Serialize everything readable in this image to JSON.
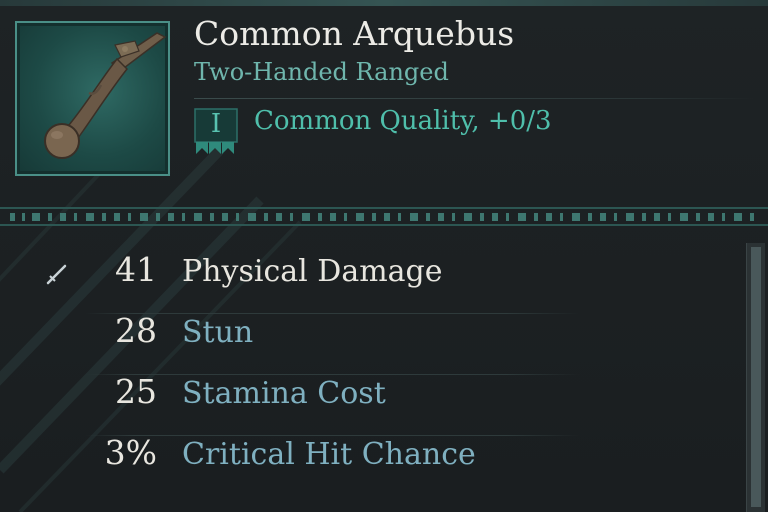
{
  "item": {
    "name": "Common Arquebus",
    "type": "Two-Handed Ranged",
    "quality_numeral": "I",
    "quality_text": "Common Quality, +0/3",
    "icon": "arquebus-icon"
  },
  "stats": [
    {
      "value": "41",
      "label": "Physical Damage",
      "highlight": true
    },
    {
      "value": "28",
      "label": "Stun",
      "highlight": false
    },
    {
      "value": "25",
      "label": "Stamina Cost",
      "highlight": false
    },
    {
      "value": "3%",
      "label": "Critical Hit Chance",
      "highlight": false
    }
  ],
  "colors": {
    "accent": "#4fbfab",
    "title": "#ecebe6",
    "label_primary": "#e8e6df",
    "label_secondary": "#7fb0c0"
  }
}
